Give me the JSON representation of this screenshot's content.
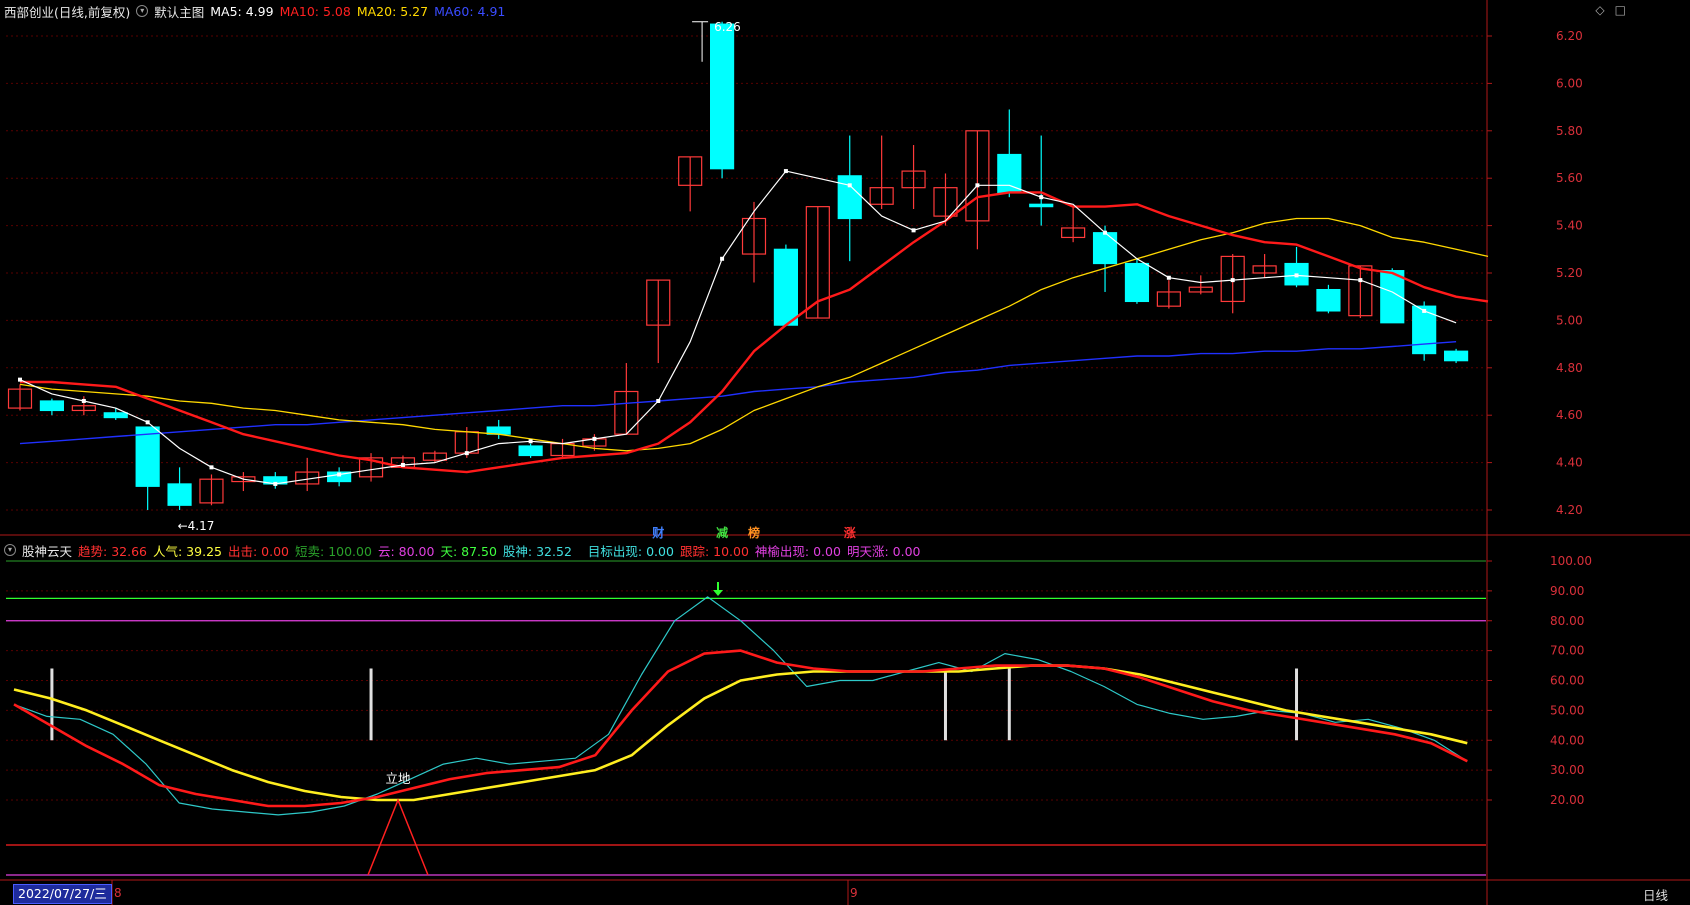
{
  "main_header": {
    "stock": "西部创业(日线,前复权)",
    "collapse": "▾",
    "template": "默认主图",
    "ma5": "MA5: 4.99",
    "ma10": "MA10: 5.08",
    "ma20": "MA20: 5.27",
    "ma60": "MA60: 4.91",
    "colors": {
      "ma5": "#ffffff",
      "ma10": "#ff2020",
      "ma20": "#ffd800",
      "ma60": "#2a3cff"
    }
  },
  "top_icons": [
    "◇",
    "□"
  ],
  "indicator_header": {
    "name": "股神云天",
    "items": [
      {
        "text": "趋势: 32.66",
        "color": "#ff3030"
      },
      {
        "text": "人气: 39.25",
        "color": "#ffff40"
      },
      {
        "text": "出击: 0.00",
        "color": "#ff3030"
      },
      {
        "text": "短卖: 100.00",
        "color": "#2aa02a"
      },
      {
        "text": "云: 80.00",
        "color": "#e040e0"
      },
      {
        "text": "天: 87.50",
        "color": "#40ff40"
      },
      {
        "text": "股神: 32.52",
        "color": "#40e0e0"
      },
      {
        "text": "目标出现: 0.00",
        "color": "#40e0e0"
      },
      {
        "text": "跟踪: 10.00",
        "color": "#ff3030"
      },
      {
        "text": "神榆出现: 0.00",
        "color": "#e040e0"
      },
      {
        "text": "明天涨: 0.00",
        "color": "#e040e0"
      }
    ]
  },
  "price_axis": {
    "ticks": [
      {
        "label": "6.20",
        "value": 6.2
      },
      {
        "label": "6.00",
        "value": 6.0
      },
      {
        "label": "5.80",
        "value": 5.8
      },
      {
        "label": "5.60",
        "value": 5.6
      },
      {
        "label": "5.40",
        "value": 5.4
      },
      {
        "label": "5.20",
        "value": 5.2
      },
      {
        "label": "5.00",
        "value": 5.0
      },
      {
        "label": "4.80",
        "value": 4.8
      },
      {
        "label": "4.60",
        "value": 4.6
      },
      {
        "label": "4.40",
        "value": 4.4
      },
      {
        "label": "4.20",
        "value": 4.2
      }
    ],
    "max_label": "6.26",
    "min_label": "←4.17",
    "max_value": 6.26,
    "min_value": 4.17
  },
  "indicator_axis": {
    "ticks": [
      {
        "label": "100.00",
        "value": 100
      },
      {
        "label": "90.00",
        "value": 90
      },
      {
        "label": "80.00",
        "value": 80
      },
      {
        "label": "70.00",
        "value": 70
      },
      {
        "label": "60.00",
        "value": 60
      },
      {
        "label": "50.00",
        "value": 50
      },
      {
        "label": "40.00",
        "value": 40
      },
      {
        "label": "30.00",
        "value": 30
      },
      {
        "label": "20.00",
        "value": 20
      }
    ]
  },
  "event_badges": [
    {
      "text": "财",
      "color": "#4080ff",
      "index": 20
    },
    {
      "text": "减",
      "color": "#40e040",
      "index": 22
    },
    {
      "text": "榜",
      "color": "#ff9020",
      "index": 23
    },
    {
      "text": "涨",
      "color": "#ff3030",
      "index": 26
    }
  ],
  "signal_label": "立地",
  "month_markers": [
    {
      "text": "8",
      "index": 3
    },
    {
      "text": "9",
      "index": 26
    }
  ],
  "bottom_date": "2022/07/27/三",
  "period_label": "日线",
  "candles": [
    [
      4.63,
      4.71,
      4.73,
      4.62
    ],
    [
      4.66,
      4.62,
      4.67,
      4.6
    ],
    [
      4.62,
      4.64,
      4.68,
      4.6
    ],
    [
      4.61,
      4.59,
      4.63,
      4.58
    ],
    [
      4.55,
      4.3,
      4.55,
      4.2
    ],
    [
      4.31,
      4.22,
      4.38,
      4.2
    ],
    [
      4.23,
      4.33,
      4.35,
      4.22
    ],
    [
      4.32,
      4.34,
      4.36,
      4.28
    ],
    [
      4.34,
      4.31,
      4.36,
      4.29
    ],
    [
      4.31,
      4.36,
      4.42,
      4.28
    ],
    [
      4.36,
      4.32,
      4.38,
      4.3
    ],
    [
      4.34,
      4.42,
      4.44,
      4.32
    ],
    [
      4.38,
      4.42,
      4.43,
      4.38
    ],
    [
      4.41,
      4.44,
      4.45,
      4.4
    ],
    [
      4.44,
      4.53,
      4.55,
      4.42
    ],
    [
      4.55,
      4.52,
      4.58,
      4.5
    ],
    [
      4.47,
      4.43,
      4.48,
      4.42
    ],
    [
      4.43,
      4.48,
      4.5,
      4.42
    ],
    [
      4.47,
      4.5,
      4.52,
      4.45
    ],
    [
      4.52,
      4.7,
      4.82,
      4.52
    ],
    [
      4.98,
      5.17,
      5.17,
      4.82
    ],
    [
      5.57,
      5.69,
      5.69,
      5.46
    ],
    [
      6.25,
      5.64,
      6.26,
      5.6
    ],
    [
      5.28,
      5.43,
      5.5,
      5.16
    ],
    [
      5.3,
      4.98,
      5.32,
      4.98
    ],
    [
      5.01,
      5.48,
      5.48,
      5.01
    ],
    [
      5.61,
      5.43,
      5.78,
      5.25
    ],
    [
      5.49,
      5.56,
      5.78,
      5.47
    ],
    [
      5.56,
      5.63,
      5.74,
      5.47
    ],
    [
      5.44,
      5.56,
      5.62,
      5.4
    ],
    [
      5.42,
      5.8,
      5.8,
      5.3
    ],
    [
      5.7,
      5.54,
      5.89,
      5.52
    ],
    [
      5.49,
      5.48,
      5.78,
      5.4
    ],
    [
      5.35,
      5.39,
      5.48,
      5.33
    ],
    [
      5.37,
      5.24,
      5.4,
      5.12
    ],
    [
      5.24,
      5.08,
      5.26,
      5.07
    ],
    [
      5.06,
      5.12,
      5.17,
      5.05
    ],
    [
      5.12,
      5.14,
      5.19,
      5.11
    ],
    [
      5.08,
      5.27,
      5.28,
      5.03
    ],
    [
      5.2,
      5.23,
      5.28,
      5.18
    ],
    [
      5.24,
      5.15,
      5.31,
      5.14
    ],
    [
      5.13,
      5.04,
      5.15,
      5.03
    ],
    [
      5.02,
      5.23,
      5.23,
      5.01
    ],
    [
      5.21,
      4.99,
      5.22,
      4.99
    ],
    [
      5.06,
      4.86,
      5.08,
      4.83
    ],
    [
      4.87,
      4.83,
      4.88,
      4.82
    ]
  ],
  "ma5": [
    4.75,
    4.69,
    4.66,
    4.63,
    4.57,
    4.46,
    4.38,
    4.33,
    4.31,
    4.33,
    4.35,
    4.37,
    4.39,
    4.4,
    4.44,
    4.48,
    4.49,
    4.48,
    4.5,
    4.52,
    4.66,
    4.91,
    5.26,
    5.46,
    5.63,
    5.6,
    5.57,
    5.44,
    5.38,
    5.42,
    5.57,
    5.57,
    5.52,
    5.49,
    5.37,
    5.26,
    5.18,
    5.16,
    5.17,
    5.18,
    5.19,
    5.18,
    5.17,
    5.12,
    5.04,
    4.99
  ],
  "ma10": [
    4.74,
    4.74,
    4.73,
    4.72,
    4.67,
    4.62,
    4.57,
    4.52,
    4.49,
    4.46,
    4.43,
    4.41,
    4.38,
    4.37,
    4.36,
    4.38,
    4.4,
    4.42,
    4.43,
    4.44,
    4.48,
    4.57,
    4.7,
    4.87,
    4.98,
    5.08,
    5.13,
    5.23,
    5.33,
    5.42,
    5.52,
    5.54,
    5.54,
    5.48,
    5.48,
    5.49,
    5.44,
    5.4,
    5.36,
    5.33,
    5.32,
    5.27,
    5.22,
    5.2,
    5.14,
    5.1,
    5.08
  ],
  "ma20": [
    4.73,
    4.71,
    4.7,
    4.69,
    4.68,
    4.66,
    4.65,
    4.63,
    4.62,
    4.6,
    4.58,
    4.57,
    4.56,
    4.54,
    4.53,
    4.52,
    4.5,
    4.48,
    4.46,
    4.45,
    4.46,
    4.48,
    4.54,
    4.62,
    4.67,
    4.72,
    4.76,
    4.82,
    4.88,
    4.94,
    5.0,
    5.06,
    5.13,
    5.18,
    5.22,
    5.26,
    5.3,
    5.34,
    5.37,
    5.41,
    5.43,
    5.43,
    5.4,
    5.35,
    5.33,
    5.3,
    5.27
  ],
  "ma60": [
    4.48,
    4.49,
    4.5,
    4.51,
    4.52,
    4.53,
    4.54,
    4.55,
    4.56,
    4.56,
    4.57,
    4.58,
    4.59,
    4.6,
    4.61,
    4.62,
    4.63,
    4.64,
    4.64,
    4.65,
    4.66,
    4.67,
    4.68,
    4.7,
    4.71,
    4.72,
    4.74,
    4.75,
    4.76,
    4.78,
    4.79,
    4.81,
    4.82,
    4.83,
    4.84,
    4.85,
    4.85,
    4.86,
    4.86,
    4.87,
    4.87,
    4.88,
    4.88,
    4.89,
    4.9,
    4.91
  ],
  "ind_red": [
    52,
    45,
    38,
    32,
    25,
    22,
    20,
    18,
    18,
    19,
    21,
    24,
    27,
    29,
    30,
    31,
    35,
    50,
    63,
    69,
    70,
    66,
    64,
    63,
    63,
    63,
    64,
    65,
    65,
    65,
    64,
    61,
    57,
    53,
    50,
    48,
    46,
    44,
    42,
    39,
    33
  ],
  "ind_yellow": [
    57,
    54,
    50,
    45,
    40,
    35,
    30,
    26,
    23,
    21,
    20,
    20,
    22,
    24,
    26,
    28,
    30,
    35,
    45,
    54,
    60,
    62,
    63,
    63,
    63,
    63,
    63,
    64,
    65,
    65,
    64,
    62,
    59,
    56,
    53,
    50,
    48,
    46,
    44,
    42,
    39
  ],
  "ind_cyan": [
    52,
    48,
    47,
    42,
    32,
    19,
    17,
    16,
    15,
    16,
    18,
    22,
    27,
    32,
    34,
    32,
    33,
    34,
    42,
    62,
    80,
    88,
    80,
    70,
    58,
    60,
    60,
    63,
    66,
    63,
    69,
    67,
    63,
    58,
    52,
    49,
    47,
    48,
    50,
    49,
    46,
    47,
    44,
    40,
    33
  ],
  "white_bar_indices": [
    1,
    11,
    29,
    31,
    40
  ],
  "colors": {
    "up": "#ff3a3a",
    "down": "#00ffff",
    "grid": "#5a0000",
    "frame": "#b01818"
  }
}
